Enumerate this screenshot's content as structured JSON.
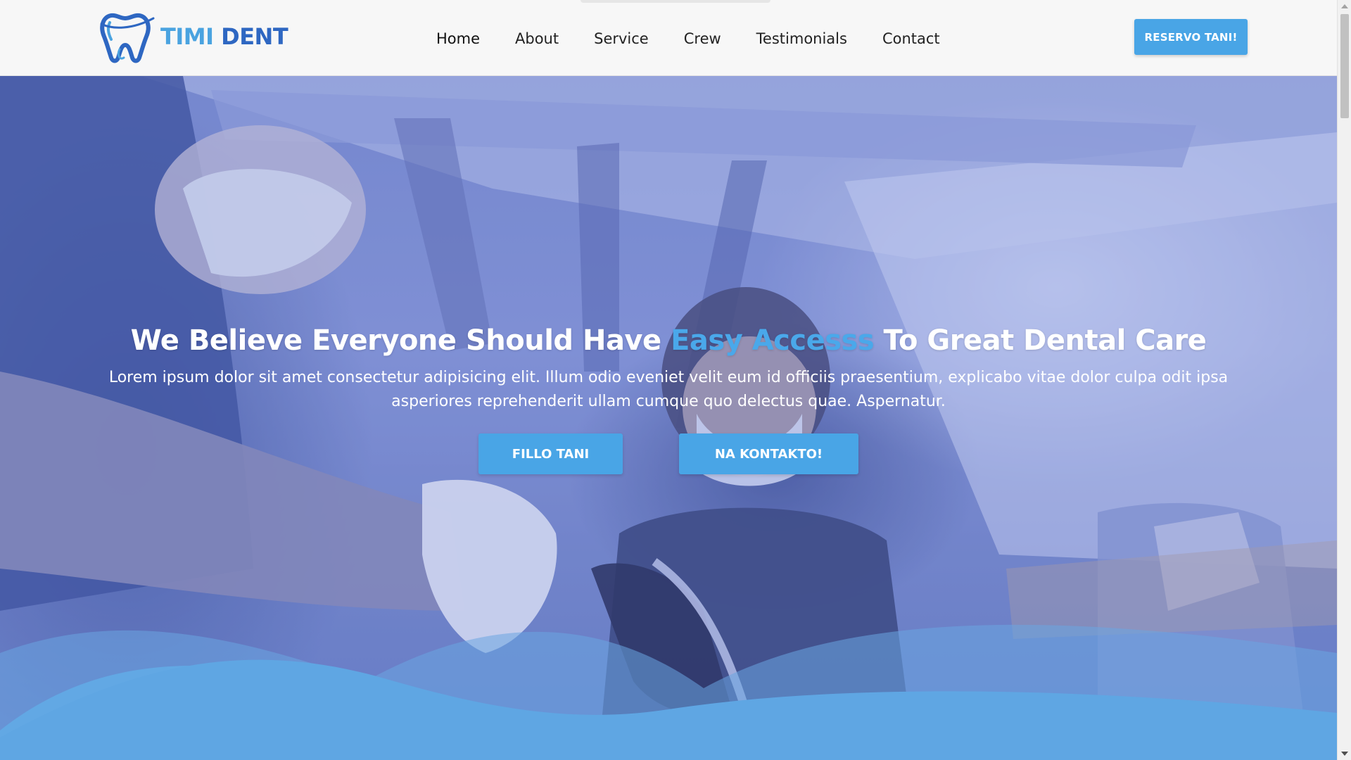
{
  "brand": {
    "name_part1": "TIMI",
    "name_part2": "DENT",
    "icon": "tooth-logo-icon",
    "colors": {
      "light_blue": "#4aa3e0",
      "dark_blue": "#2e67c2"
    }
  },
  "nav": {
    "items": [
      {
        "label": "Home"
      },
      {
        "label": "About"
      },
      {
        "label": "Service"
      },
      {
        "label": "Crew"
      },
      {
        "label": "Testimonials"
      },
      {
        "label": "Contact"
      }
    ]
  },
  "header": {
    "cta_label": "RESERVO TANI!"
  },
  "hero": {
    "title_before": "We Believe Everyone Should Have ",
    "title_accent": "Easy Accesss",
    "title_after": " To Great Dental Care",
    "subtitle": "Lorem ipsum dolor sit amet consectetur adipisicing elit. Illum odio eveniet velit eum id officiis praesentium, explicabo vitae dolor culpa odit ipsa asperiores reprehenderit ullam cumque quo delectus quae. Aspernatur.",
    "primary_button": "FILLO TANI",
    "secondary_button": "NA KONTAKTO!",
    "accent_color": "#4aa8ea",
    "button_color": "#49a5e6"
  },
  "scrollbar": {
    "up_icon": "scroll-up-arrow-icon",
    "down_icon": "scroll-down-arrow-icon"
  }
}
